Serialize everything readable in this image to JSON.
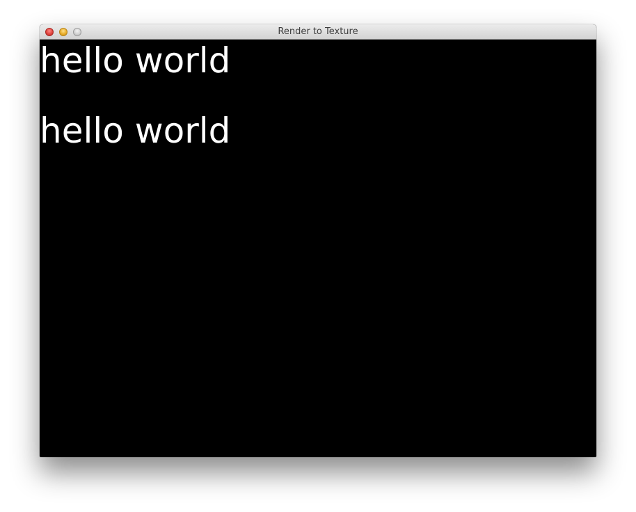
{
  "window": {
    "title": "Render to Texture"
  },
  "content": {
    "lines": [
      "hello world",
      "hello world"
    ],
    "background": "#000000",
    "text_color": "#ffffff"
  },
  "controls": {
    "close_icon": "close-icon",
    "minimize_icon": "minimize-icon",
    "zoom_icon": "zoom-icon"
  }
}
